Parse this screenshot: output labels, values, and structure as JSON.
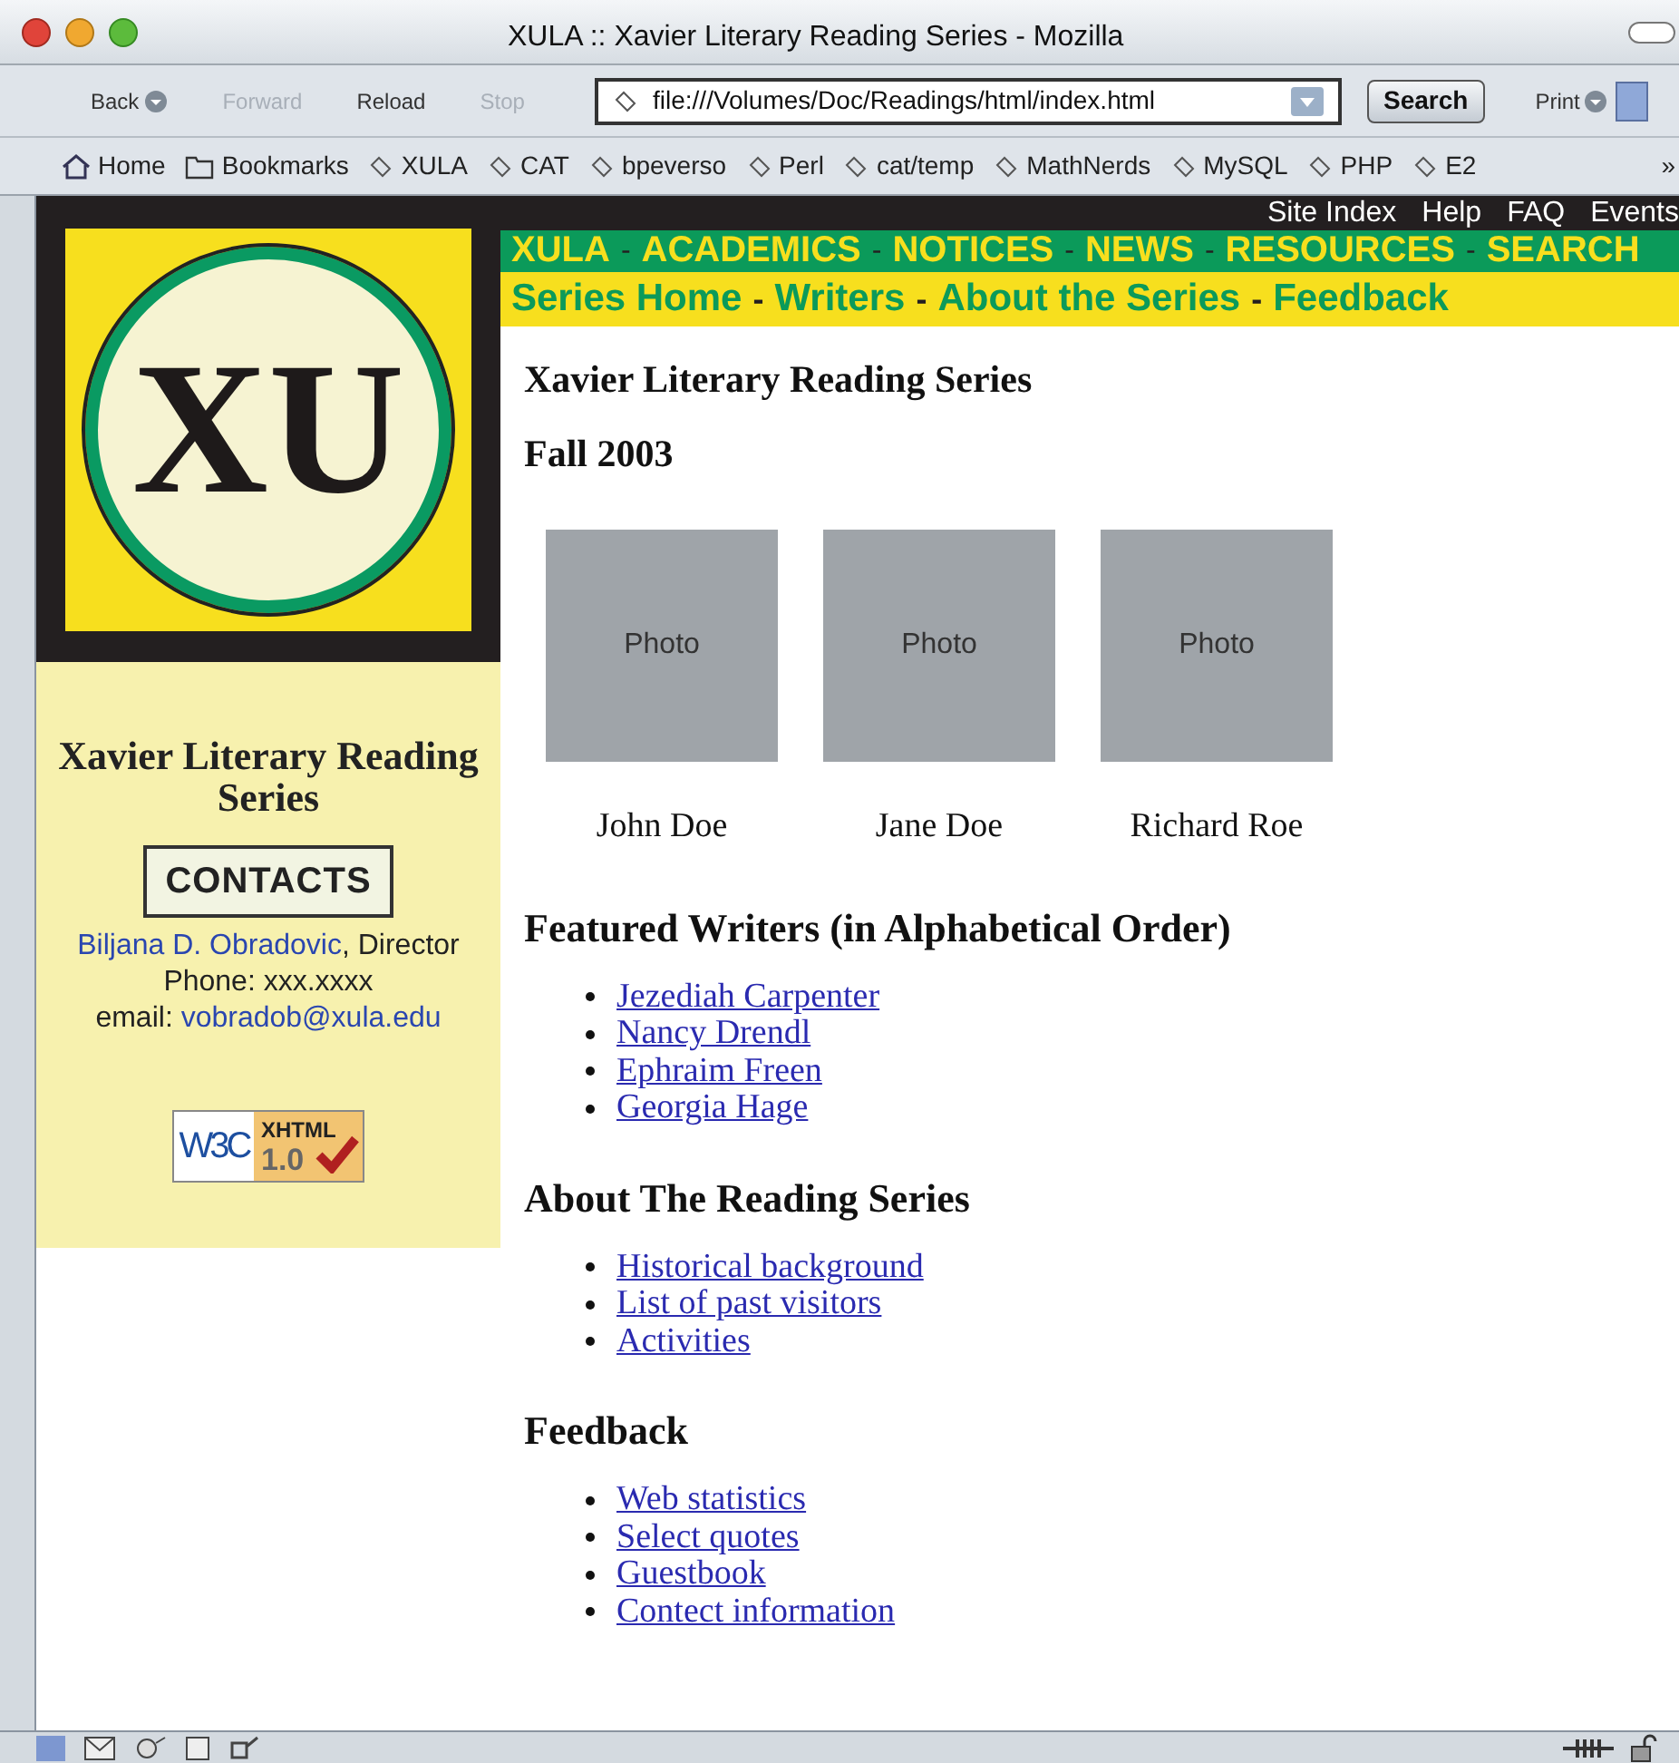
{
  "window": {
    "title": "XULA :: Xavier Literary Reading Series - Mozilla"
  },
  "toolbar": {
    "buttons": [
      {
        "label": "Back",
        "disabled": false,
        "menu": true
      },
      {
        "label": "Forward",
        "disabled": true,
        "menu": false
      },
      {
        "label": "Reload",
        "disabled": false,
        "menu": false
      },
      {
        "label": "Stop",
        "disabled": true,
        "menu": false
      }
    ],
    "url": "file:///Volumes/Doc/Readings/html/index.html",
    "search_button": "Search",
    "print_button": "Print"
  },
  "bookmarks": [
    {
      "label": "Home",
      "kind": "home"
    },
    {
      "label": "Bookmarks",
      "kind": "folder"
    },
    {
      "label": "XULA",
      "kind": "bookmark"
    },
    {
      "label": "CAT",
      "kind": "bookmark"
    },
    {
      "label": "bpeverso",
      "kind": "bookmark"
    },
    {
      "label": "Perl",
      "kind": "bookmark"
    },
    {
      "label": "cat/temp",
      "kind": "bookmark"
    },
    {
      "label": "MathNerds",
      "kind": "bookmark"
    },
    {
      "label": "MySQL",
      "kind": "bookmark"
    },
    {
      "label": "PHP",
      "kind": "bookmark"
    },
    {
      "label": "E2",
      "kind": "bookmark"
    }
  ],
  "bookmarks_overflow": "»",
  "page": {
    "logo_text": "XU",
    "top_links": [
      "Site Index",
      "Help",
      "FAQ",
      "Events"
    ],
    "main_nav": {
      "separator": "-",
      "items": [
        "XULA",
        "ACADEMICS",
        "NOTICES",
        "NEWS",
        "RESOURCES",
        "SEARCH"
      ]
    },
    "series_nav": {
      "separator": "-",
      "items": [
        "Series Home",
        "Writers",
        "About the Series",
        "Feedback"
      ]
    },
    "sidebar": {
      "heading": "Xavier Literary Reading Series",
      "contacts_button": "CONTACTS",
      "director_name": "Biljana D. Obradovic",
      "director_role": ", Director",
      "phone": "Phone: xxx.xxxx",
      "email_label": "email:",
      "email": "vobradob@xula.edu",
      "badge": {
        "w3c": "W3C",
        "standard": "XHTML",
        "version": "1.0"
      }
    },
    "title": "Xavier Literary Reading Series",
    "season": "Fall 2003",
    "photos": [
      {
        "caption": "Photo",
        "name": "John Doe"
      },
      {
        "caption": "Photo",
        "name": "Jane Doe"
      },
      {
        "caption": "Photo",
        "name": "Richard Roe"
      }
    ],
    "sections": [
      {
        "heading": "Featured Writers (in Alphabetical Order)",
        "links": [
          "Jezediah Carpenter",
          "Nancy Drendl",
          "Ephraim Freen",
          "Georgia Hage"
        ]
      },
      {
        "heading": "About The Reading Series",
        "links": [
          "Historical background",
          "List of past visitors",
          "Activities"
        ]
      },
      {
        "heading": "Feedback",
        "links": [
          "Web statistics",
          "Select quotes",
          "Guestbook",
          "Contect information"
        ]
      }
    ]
  }
}
